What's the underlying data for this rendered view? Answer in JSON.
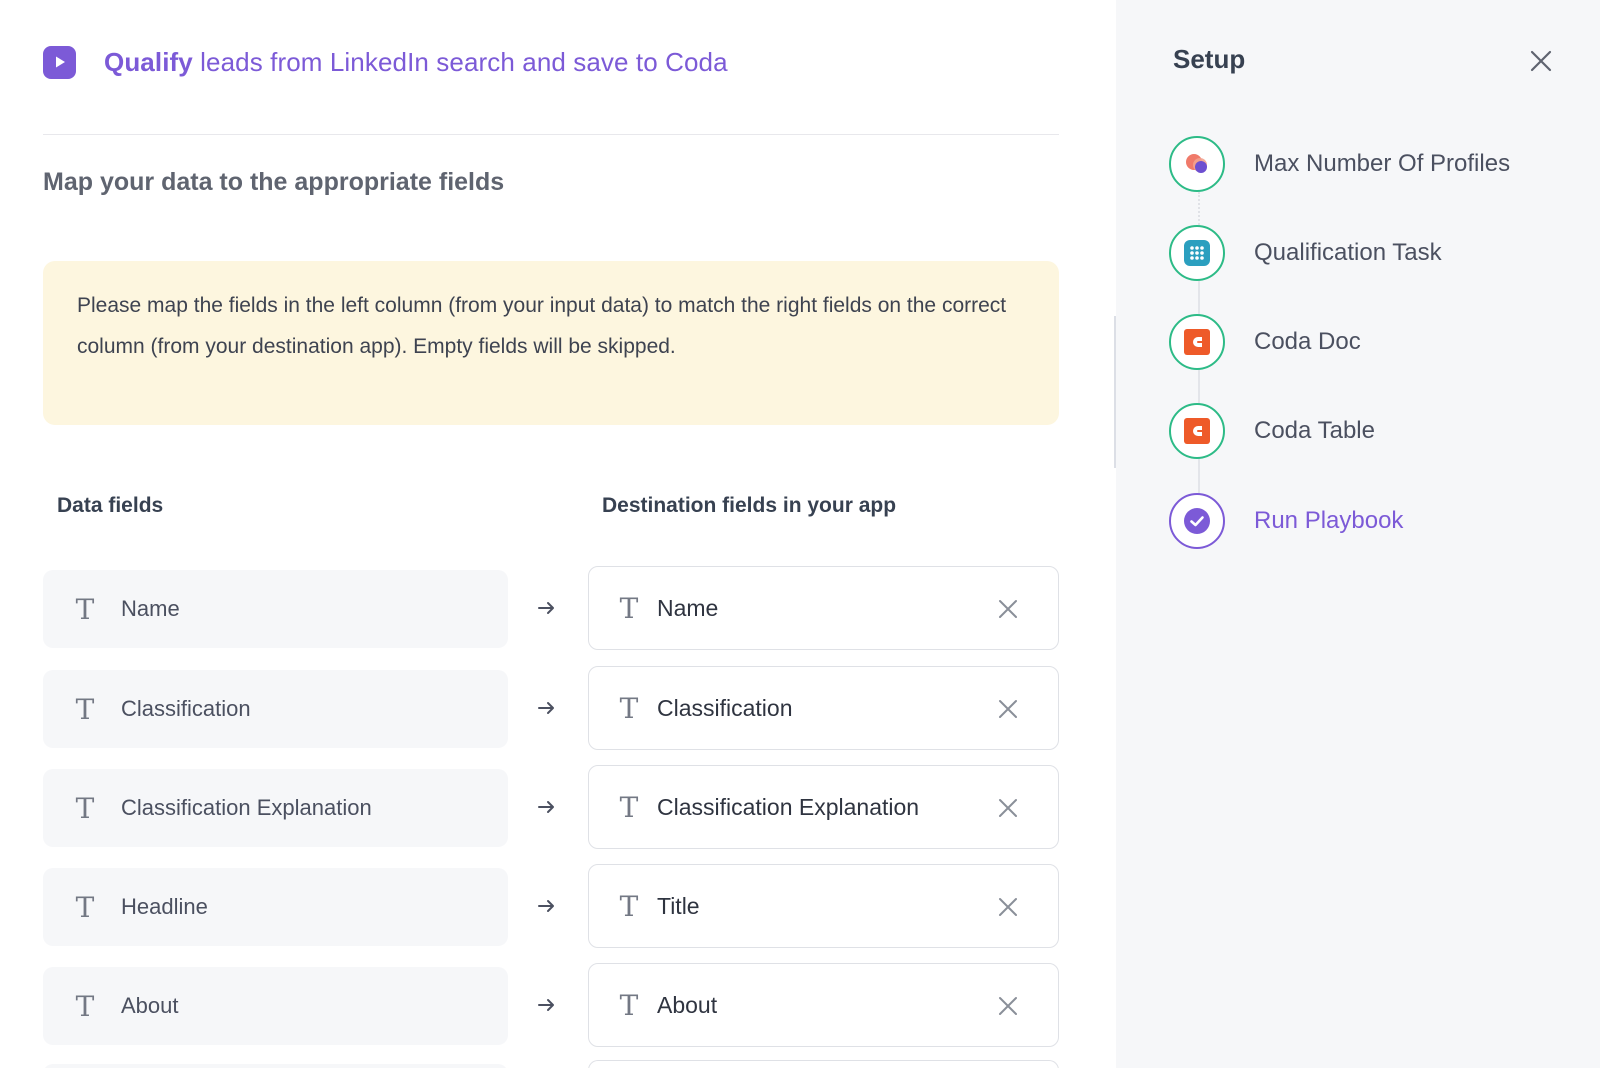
{
  "header": {
    "title_bold": "Qualify",
    "title_rest": " leads from LinkedIn search and save to Coda",
    "icon": "play-icon",
    "accent_color": "#7c5ad7"
  },
  "main": {
    "subtitle": "Map your data to the appropriate fields",
    "notice": "Please map the fields in the left column (from your input data) to match the right fields on the correct column (from your destination app). Empty fields will be skipped.",
    "data_fields_header": "Data fields",
    "destination_fields_header": "Destination fields in your app",
    "mappings": [
      {
        "source": "Name",
        "destination": "Name"
      },
      {
        "source": "Classification",
        "destination": "Classification"
      },
      {
        "source": "Classification Explanation",
        "destination": "Classification Explanation"
      },
      {
        "source": "Headline",
        "destination": "Title"
      },
      {
        "source": "About",
        "destination": "About"
      }
    ],
    "field_type_icon": "T",
    "arrow_icon": "arrow-right-icon",
    "remove_icon": "close-icon"
  },
  "sidebar": {
    "title": "Setup",
    "close_icon": "close-icon",
    "steps": [
      {
        "label": "Max Number Of Profiles",
        "icon": "profiles-icon",
        "status": "complete"
      },
      {
        "label": "Qualification Task",
        "icon": "task-icon",
        "status": "complete"
      },
      {
        "label": "Coda Doc",
        "icon": "coda-icon",
        "status": "complete"
      },
      {
        "label": "Coda Table",
        "icon": "coda-icon",
        "status": "complete"
      },
      {
        "label": "Run Playbook",
        "icon": "check-icon",
        "status": "active"
      }
    ],
    "complete_color": "#2dbb87",
    "coda_color": "#ee5a29"
  }
}
